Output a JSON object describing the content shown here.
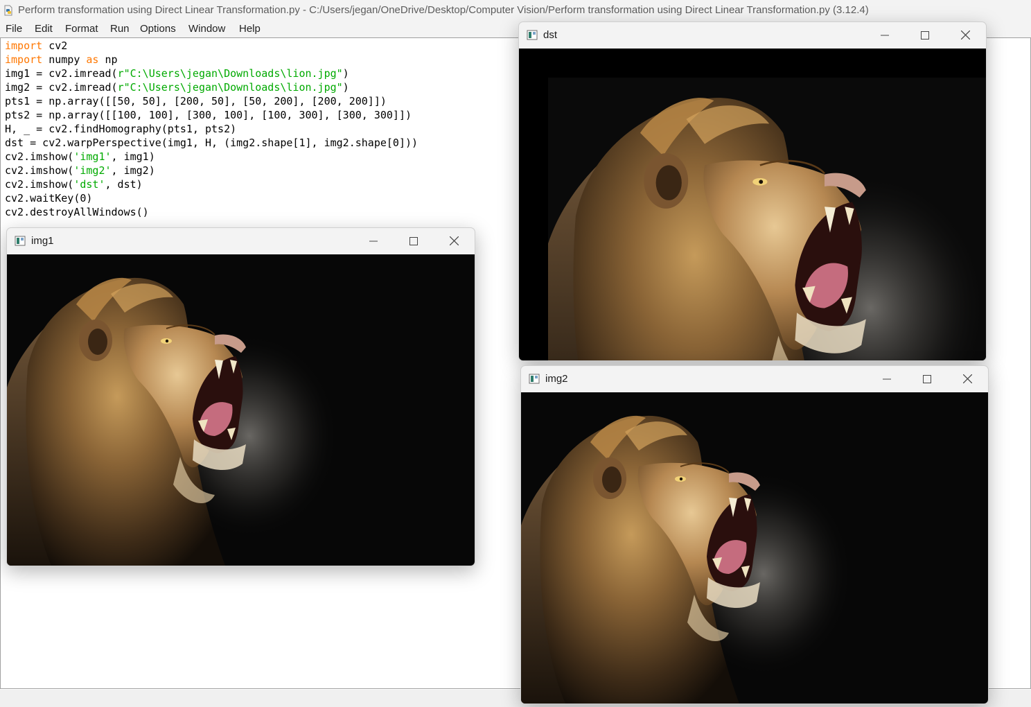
{
  "idle": {
    "title": "Perform transformation using Direct Linear Transformation.py - C:/Users/jegan/OneDrive/Desktop/Computer Vision/Perform transformation using Direct Linear Transformation.py (3.12.4)",
    "menu": [
      "File",
      "Edit",
      "Format",
      "Run",
      "Options",
      "Window",
      "Help"
    ],
    "code_lines": [
      [
        [
          "kw",
          "import"
        ],
        [
          "",
          " cv2"
        ]
      ],
      [
        [
          "kw",
          "import"
        ],
        [
          "",
          " numpy "
        ],
        [
          "kw",
          "as"
        ],
        [
          "",
          " np"
        ]
      ],
      [
        [
          "",
          "img1 = cv2.imread("
        ],
        [
          "str",
          "r\"C:\\Users\\jegan\\Downloads\\lion.jpg\""
        ],
        [
          "",
          ")"
        ]
      ],
      [
        [
          "",
          "img2 = cv2.imread("
        ],
        [
          "str",
          "r\"C:\\Users\\jegan\\Downloads\\lion.jpg\""
        ],
        [
          "",
          ")"
        ]
      ],
      [
        [
          "",
          "pts1 = np.array([[50, 50], [200, 50], [50, 200], [200, 200]])"
        ]
      ],
      [
        [
          "",
          "pts2 = np.array([[100, 100], [300, 100], [100, 300], [300, 300]])"
        ]
      ],
      [
        [
          "",
          "H, _ = cv2.findHomography(pts1, pts2)"
        ]
      ],
      [
        [
          "",
          "dst = cv2.warpPerspective(img1, H, (img2.shape[1], img2.shape[0]))"
        ]
      ],
      [
        [
          "",
          "cv2.imshow("
        ],
        [
          "str",
          "'img1'"
        ],
        [
          "",
          ", img1)"
        ]
      ],
      [
        [
          "",
          "cv2.imshow("
        ],
        [
          "str",
          "'img2'"
        ],
        [
          "",
          ", img2)"
        ]
      ],
      [
        [
          "",
          "cv2.imshow("
        ],
        [
          "str",
          "'dst'"
        ],
        [
          "",
          ", dst)"
        ]
      ],
      [
        [
          "",
          "cv2.waitKey(0)"
        ]
      ],
      [
        [
          "",
          "cv2.destroyAllWindows()"
        ]
      ]
    ],
    "syntax_colors": {
      "keyword": "#ff7700",
      "string": "#00aa00"
    }
  },
  "windows": {
    "img1": {
      "title": "img1"
    },
    "dst": {
      "title": "dst"
    },
    "img2": {
      "title": "img2"
    }
  }
}
